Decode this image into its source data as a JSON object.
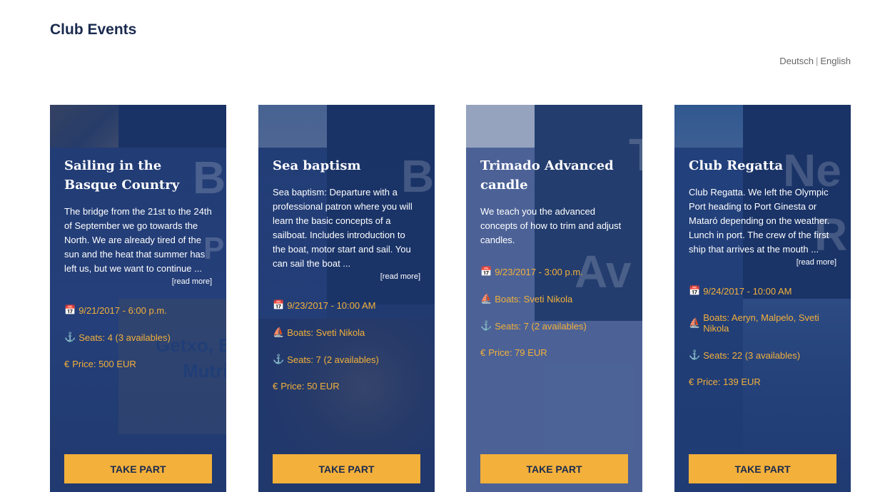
{
  "page": {
    "title": "Club Events"
  },
  "language": {
    "de": "Deutsch",
    "en": "English",
    "separator": "|"
  },
  "colors": {
    "accent": "#f3b03a",
    "navy": "#0f2a56",
    "title": "#1a2b4f"
  },
  "cards": [
    {
      "bg_letters": "B",
      "bg_text": [
        "P",
        "Getxo, B",
        "Mutri"
      ],
      "title": "Sailing in the Basque Country",
      "description": "The bridge from the 21st to the 24th of September we go towards the North. We are already tired of the sun and the heat that summer has left us, but we want to continue ...",
      "read_more": "[read more]",
      "date": "9/21/2017 - 6:00 p.m.",
      "seats": "Seats: 4 (3 availables)",
      "price": "Price: 500 EUR",
      "button": "TAKE PART"
    },
    {
      "bg_letters": "B",
      "title": "Sea baptism",
      "description": "Sea baptism: Departure with a professional patron where you will learn the basic concepts of a sailboat. Includes introduction to the boat, motor start and sail. You can sail the boat ...",
      "read_more": "[read more]",
      "date": "9/23/2017 - 10:00 AM",
      "boats": "Boats: Sveti Nikola",
      "seats": "Seats: 7 (2 availables)",
      "price": "Price: 50 EUR",
      "button": "TAKE PART"
    },
    {
      "bg_letters": "T",
      "bg_text": [
        "Av"
      ],
      "title": "Trimado Advanced candle",
      "description": "We teach you the advanced concepts of how to trim and adjust candles.",
      "date": "9/23/2017 - 3:00 p.m.",
      "boats": "Boats: Sveti Nikola",
      "seats": "Seats: 7 (2 availables)",
      "price": "Price: 79 EUR",
      "button": "TAKE PART"
    },
    {
      "bg_letters": "Ne",
      "bg_text": [
        "R"
      ],
      "title": "Club Regatta",
      "description": "Club Regatta. We left the Olympic Port heading to Port Ginesta or Mataró depending on the weather. Lunch in port. The crew of the first ship that arrives at the mouth ...",
      "read_more": "[read more]",
      "date": "9/24/2017 - 10:00 AM",
      "boats": "Boats: Aeryn, Malpelo, Sveti Nikola",
      "seats": "Seats: 22 (3 availables)",
      "price": "Price: 139 EUR",
      "button": "TAKE PART"
    }
  ]
}
